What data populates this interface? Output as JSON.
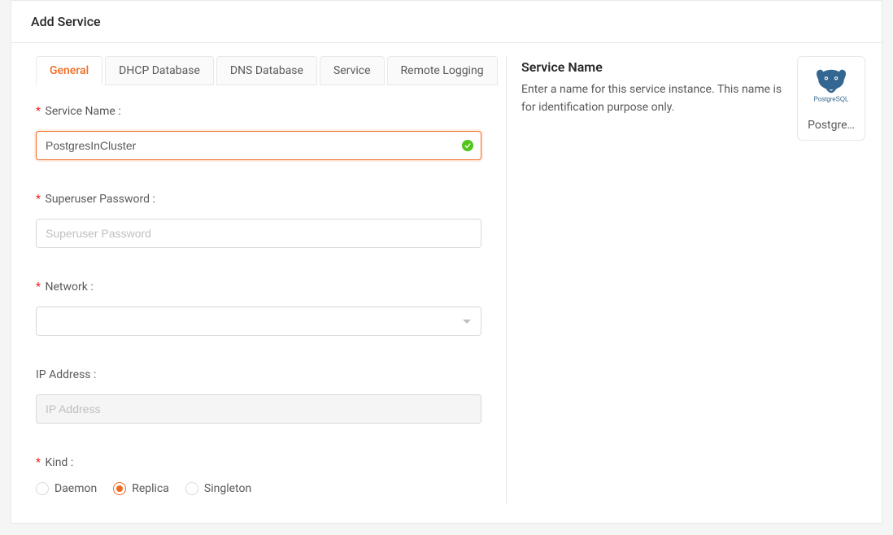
{
  "header": {
    "title": "Add Service"
  },
  "tabs": [
    {
      "label": "General",
      "active": true
    },
    {
      "label": "DHCP Database",
      "active": false
    },
    {
      "label": "DNS Database",
      "active": false
    },
    {
      "label": "Service",
      "active": false
    },
    {
      "label": "Remote Logging",
      "active": false
    }
  ],
  "form": {
    "serviceName": {
      "label": "Service Name",
      "value": "PostgresInCluster",
      "required": true
    },
    "superuserPassword": {
      "label": "Superuser Password",
      "placeholder": "Superuser Password",
      "value": "",
      "required": true
    },
    "network": {
      "label": "Network",
      "value": "",
      "required": true
    },
    "ipAddress": {
      "label": "IP Address",
      "placeholder": "IP Address",
      "value": "",
      "required": false,
      "disabled": true
    },
    "kind": {
      "label": "Kind",
      "required": true,
      "options": [
        {
          "label": "Daemon",
          "checked": false
        },
        {
          "label": "Replica",
          "checked": true
        },
        {
          "label": "Singleton",
          "checked": false
        }
      ]
    }
  },
  "help": {
    "title": "Service Name",
    "text": "Enter a name for this service instance. This name is for identification purpose only."
  },
  "sideCard": {
    "label": "Postgre…"
  },
  "colors": {
    "accent": "#f26a21",
    "success": "#52c41a"
  }
}
